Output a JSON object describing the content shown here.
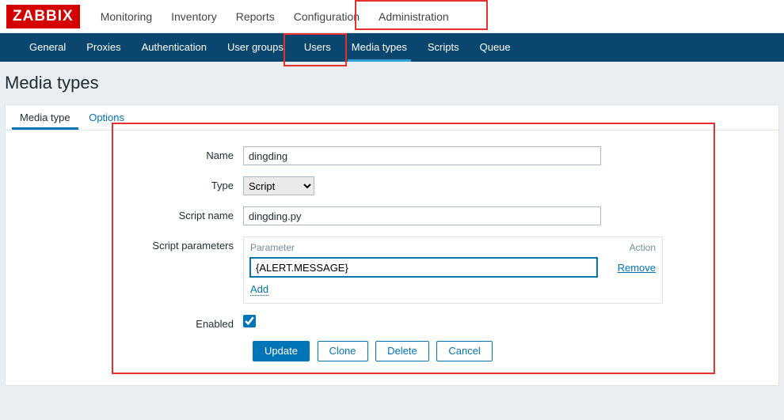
{
  "brand": "ZABBIX",
  "topnav": {
    "monitoring": "Monitoring",
    "inventory": "Inventory",
    "reports": "Reports",
    "configuration": "Configuration",
    "administration": "Administration"
  },
  "subnav": {
    "general": "General",
    "proxies": "Proxies",
    "authentication": "Authentication",
    "user_groups": "User groups",
    "users": "Users",
    "media_types": "Media types",
    "scripts": "Scripts",
    "queue": "Queue"
  },
  "page_title": "Media types",
  "tabs": {
    "media_type": "Media type",
    "options": "Options"
  },
  "form": {
    "labels": {
      "name": "Name",
      "type": "Type",
      "script_name": "Script name",
      "script_parameters": "Script parameters",
      "enabled": "Enabled"
    },
    "values": {
      "name": "dingding",
      "type": "Script",
      "script_name": "dingding.py",
      "param0": "{ALERT.MESSAGE}"
    },
    "param_table": {
      "col_parameter": "Parameter",
      "col_action": "Action",
      "remove": "Remove",
      "add": "Add"
    }
  },
  "buttons": {
    "update": "Update",
    "clone": "Clone",
    "delete": "Delete",
    "cancel": "Cancel"
  }
}
